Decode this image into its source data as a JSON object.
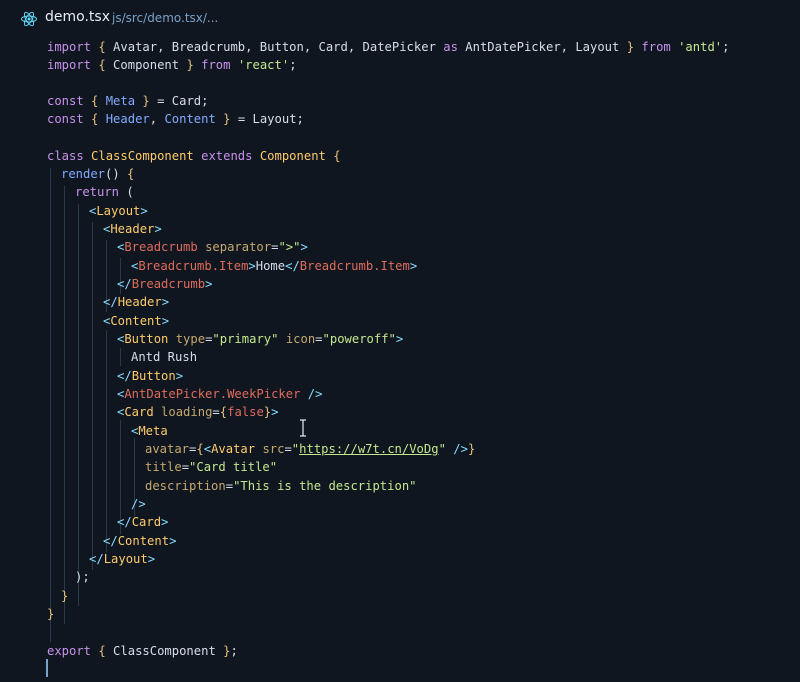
{
  "tab": {
    "title": "demo.tsx",
    "path": "js/src/demo.tsx/..."
  },
  "code": {
    "l1": [
      [
        "k",
        "import"
      ],
      [
        "p",
        " "
      ],
      [
        "b",
        "{"
      ],
      [
        "d",
        " Avatar, Breadcrumb, Button, Card, DatePicker "
      ],
      [
        "k",
        "as"
      ],
      [
        "d",
        " AntDatePicker, Layout "
      ],
      [
        "b",
        "}"
      ],
      [
        "p",
        " "
      ],
      [
        "k",
        "from"
      ],
      [
        "p",
        " "
      ],
      [
        "s",
        "'antd'"
      ],
      [
        "p",
        ";"
      ]
    ],
    "l2": [
      [
        "k",
        "import"
      ],
      [
        "p",
        " "
      ],
      [
        "b",
        "{"
      ],
      [
        "d",
        " Component "
      ],
      [
        "b",
        "}"
      ],
      [
        "p",
        " "
      ],
      [
        "k",
        "from"
      ],
      [
        "p",
        " "
      ],
      [
        "s",
        "'react'"
      ],
      [
        "p",
        ";"
      ]
    ],
    "l4": [
      [
        "k",
        "const"
      ],
      [
        "p",
        " "
      ],
      [
        "b",
        "{"
      ],
      [
        "p",
        " "
      ],
      [
        "i",
        "Meta"
      ],
      [
        "p",
        " "
      ],
      [
        "b",
        "}"
      ],
      [
        "p",
        " = Card;"
      ]
    ],
    "l5": [
      [
        "k",
        "const"
      ],
      [
        "p",
        " "
      ],
      [
        "b",
        "{"
      ],
      [
        "p",
        " "
      ],
      [
        "i",
        "Header"
      ],
      [
        "p",
        ", "
      ],
      [
        "i",
        "Content"
      ],
      [
        "p",
        " "
      ],
      [
        "b",
        "}"
      ],
      [
        "p",
        " = Layout;"
      ]
    ],
    "l7": [
      [
        "k",
        "class"
      ],
      [
        "p",
        " "
      ],
      [
        "c",
        "ClassComponent"
      ],
      [
        "p",
        " "
      ],
      [
        "k",
        "extends"
      ],
      [
        "p",
        " "
      ],
      [
        "c",
        "Component"
      ],
      [
        "p",
        " "
      ],
      [
        "b",
        "{"
      ]
    ],
    "l8": [
      [
        "f",
        "render"
      ],
      [
        "p",
        "() "
      ],
      [
        "b",
        "{"
      ]
    ],
    "l9": [
      [
        "k",
        "return"
      ],
      [
        "p",
        " ("
      ]
    ],
    "l10": [
      [
        "g",
        "<"
      ],
      [
        "c",
        "Layout"
      ],
      [
        "g",
        ">"
      ]
    ],
    "l11": [
      [
        "g",
        "<"
      ],
      [
        "c",
        "Header"
      ],
      [
        "g",
        ">"
      ]
    ],
    "l12": [
      [
        "g",
        "<"
      ],
      [
        "t",
        "Breadcrumb"
      ],
      [
        "p",
        " "
      ],
      [
        "a",
        "separator"
      ],
      [
        "p",
        "="
      ],
      [
        "s",
        "\">\""
      ],
      [
        "g",
        ">"
      ]
    ],
    "l13": [
      [
        "g",
        "<"
      ],
      [
        "t",
        "Breadcrumb.Item"
      ],
      [
        "g",
        ">"
      ],
      [
        "d",
        "Home"
      ],
      [
        "g",
        "</"
      ],
      [
        "t",
        "Breadcrumb.Item"
      ],
      [
        "g",
        ">"
      ]
    ],
    "l14": [
      [
        "g",
        "</"
      ],
      [
        "t",
        "Breadcrumb"
      ],
      [
        "g",
        ">"
      ]
    ],
    "l15": [
      [
        "g",
        "</"
      ],
      [
        "c",
        "Header"
      ],
      [
        "g",
        ">"
      ]
    ],
    "l16": [
      [
        "g",
        "<"
      ],
      [
        "c",
        "Content"
      ],
      [
        "g",
        ">"
      ]
    ],
    "l17": [
      [
        "g",
        "<"
      ],
      [
        "c",
        "Button"
      ],
      [
        "p",
        " "
      ],
      [
        "a",
        "type"
      ],
      [
        "p",
        "="
      ],
      [
        "s",
        "\"primary\""
      ],
      [
        "p",
        " "
      ],
      [
        "a",
        "icon"
      ],
      [
        "p",
        "="
      ],
      [
        "s",
        "\"poweroff\""
      ],
      [
        "g",
        ">"
      ]
    ],
    "l18": [
      [
        "d",
        "Antd Rush"
      ]
    ],
    "l19": [
      [
        "g",
        "</"
      ],
      [
        "c",
        "Button"
      ],
      [
        "g",
        ">"
      ]
    ],
    "l20": [
      [
        "g",
        "<"
      ],
      [
        "t",
        "AntDatePicker.WeekPicker"
      ],
      [
        "p",
        " "
      ],
      [
        "g",
        "/>"
      ]
    ],
    "l21": [
      [
        "g",
        "<"
      ],
      [
        "c",
        "Card"
      ],
      [
        "p",
        " "
      ],
      [
        "a",
        "loading"
      ],
      [
        "p",
        "="
      ],
      [
        "b",
        "{"
      ],
      [
        "v",
        "false"
      ],
      [
        "b",
        "}"
      ],
      [
        "g",
        ">"
      ]
    ],
    "l22": [
      [
        "g",
        "<"
      ],
      [
        "c",
        "Meta"
      ]
    ],
    "l23": [
      [
        "a",
        "avatar"
      ],
      [
        "p",
        "="
      ],
      [
        "b",
        "{"
      ],
      [
        "g",
        "<"
      ],
      [
        "c",
        "Avatar"
      ],
      [
        "p",
        " "
      ],
      [
        "a",
        "src"
      ],
      [
        "p",
        "="
      ],
      [
        "s",
        "\""
      ],
      [
        "u",
        "https://w7t.cn/VoDg"
      ],
      [
        "s",
        "\""
      ],
      [
        "p",
        " "
      ],
      [
        "g",
        "/>"
      ],
      [
        "b",
        "}"
      ]
    ],
    "l24": [
      [
        "a",
        "title"
      ],
      [
        "p",
        "="
      ],
      [
        "s",
        "\"Card title\""
      ]
    ],
    "l25": [
      [
        "a",
        "description"
      ],
      [
        "p",
        "="
      ],
      [
        "s",
        "\"This is the description\""
      ]
    ],
    "l26": [
      [
        "g",
        "/>"
      ]
    ],
    "l27": [
      [
        "g",
        "</"
      ],
      [
        "c",
        "Card"
      ],
      [
        "g",
        ">"
      ]
    ],
    "l28": [
      [
        "g",
        "</"
      ],
      [
        "c",
        "Content"
      ],
      [
        "g",
        ">"
      ]
    ],
    "l29": [
      [
        "g",
        "</"
      ],
      [
        "c",
        "Layout"
      ],
      [
        "g",
        ">"
      ]
    ],
    "l30": [
      [
        "p",
        ");"
      ]
    ],
    "l31": [
      [
        "b",
        "}"
      ]
    ],
    "l32": [
      [
        "b",
        "}"
      ]
    ],
    "l34": [
      [
        "k",
        "export"
      ],
      [
        "p",
        " "
      ],
      [
        "b",
        "{"
      ],
      [
        "d",
        " ClassComponent "
      ],
      [
        "b",
        "}"
      ],
      [
        "p",
        ";"
      ]
    ]
  },
  "colors": {
    "background": "#0f1620",
    "keyword": "#c792ea",
    "string": "#c3e88d",
    "tag": "#e06c5c",
    "component": "#ffcb6b"
  }
}
